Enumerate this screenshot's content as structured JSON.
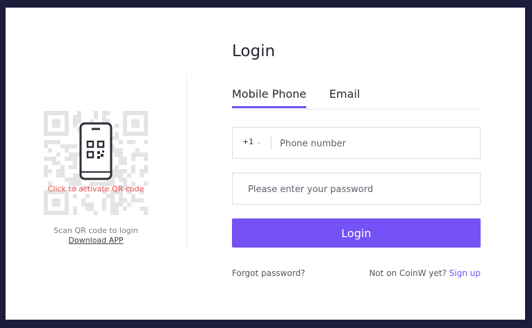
{
  "qr": {
    "activate_text": "Click to activate QR code",
    "scan_text": "Scan QR code to login",
    "download_label": "Download APP",
    "icon": "phone-qr-icon"
  },
  "form": {
    "title": "Login",
    "tabs": [
      {
        "label": "Mobile Phone",
        "active": true
      },
      {
        "label": "Email",
        "active": false
      }
    ],
    "country_code": "+1",
    "phone_placeholder": "Phone number",
    "password_placeholder": "Please enter your password",
    "login_label": "Login",
    "forgot_label": "Forgot password?",
    "signup_prompt": "Not on CoinW yet?",
    "signup_label": "Sign up"
  },
  "colors": {
    "accent": "#7452f5",
    "background": "#1b1d3a",
    "error_red": "#f04a4a"
  }
}
